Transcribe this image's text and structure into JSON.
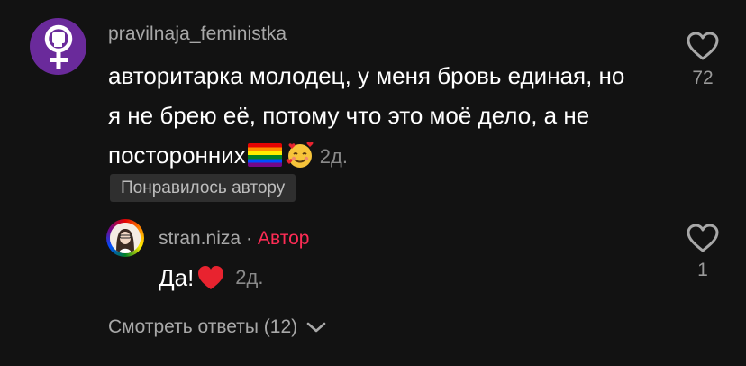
{
  "comment": {
    "username": "pravilnaja_feministka",
    "text": "авторитарка молодец, у меня бровь единая, но я не брею её, потому что это моё дело, а не посторонних",
    "emojis": [
      "rainbow-flag",
      "smiling-face-with-hearts"
    ],
    "date": "2д.",
    "creator_badge": "Понравилось автору",
    "like_count": "72",
    "avatar_icon": "feminist-fist-symbol-icon",
    "avatar_color": "#6a2a9b"
  },
  "reply": {
    "username": "stran.niza",
    "separator": "·",
    "author_label": "Автор",
    "text": "Да!",
    "emoji": "red-heart",
    "date": "2д.",
    "like_count": "1"
  },
  "view_replies": {
    "label": "Смотреть ответы (12)"
  },
  "colors": {
    "background": "#121212",
    "author_accent": "#fe2c55",
    "secondary_text": "#a8a8a8"
  }
}
